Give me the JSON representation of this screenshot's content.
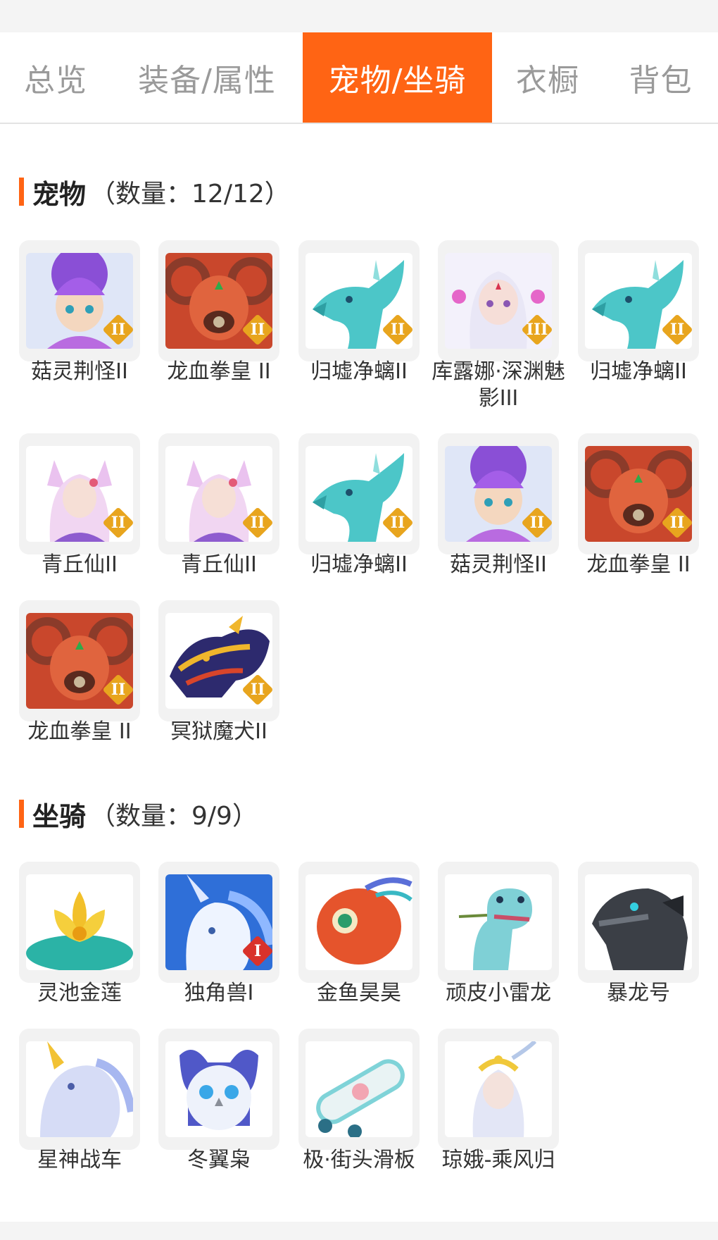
{
  "tabs": [
    {
      "label": "总览",
      "active": false
    },
    {
      "label": "装备/属性",
      "active": false
    },
    {
      "label": "宠物/坐骑",
      "active": true
    },
    {
      "label": "衣橱",
      "active": false
    },
    {
      "label": "背包",
      "active": false
    }
  ],
  "pets": {
    "title": "宠物",
    "count_text": "（数量：12/12）",
    "items": [
      {
        "name": "菇灵荆怪II",
        "icon": "mushroom-sprite-icon",
        "badge": "II"
      },
      {
        "name": "龙血拳皇 II",
        "icon": "ram-demon-icon",
        "badge": "II"
      },
      {
        "name": "归墟净螭II",
        "icon": "cyan-dragon-icon",
        "badge": "II"
      },
      {
        "name": "库露娜·深渊魅影III",
        "icon": "white-hair-girl-icon",
        "badge": "III"
      },
      {
        "name": "归墟净螭II",
        "icon": "cyan-dragon-icon",
        "badge": "II"
      },
      {
        "name": "青丘仙II",
        "icon": "fox-fairy-icon",
        "badge": "II"
      },
      {
        "name": "青丘仙II",
        "icon": "fox-fairy-icon",
        "badge": "II"
      },
      {
        "name": "归墟净螭II",
        "icon": "cyan-dragon-icon",
        "badge": "II"
      },
      {
        "name": "菇灵荆怪II",
        "icon": "mushroom-sprite-icon",
        "badge": "II"
      },
      {
        "name": "龙血拳皇 II",
        "icon": "ram-demon-icon",
        "badge": "II"
      },
      {
        "name": "龙血拳皇 II",
        "icon": "ram-demon-icon",
        "badge": "II"
      },
      {
        "name": "冥狱魔犬II",
        "icon": "hell-hound-icon",
        "badge": "II"
      }
    ]
  },
  "mounts": {
    "title": "坐骑",
    "count_text": "（数量：9/9）",
    "items": [
      {
        "name": "灵池金莲",
        "icon": "golden-lotus-icon",
        "badge": ""
      },
      {
        "name": "独角兽I",
        "icon": "unicorn-icon",
        "badge": "I"
      },
      {
        "name": "金鱼昊昊",
        "icon": "goldfish-icon",
        "badge": ""
      },
      {
        "name": "顽皮小雷龙",
        "icon": "little-dinosaur-icon",
        "badge": ""
      },
      {
        "name": "暴龙号",
        "icon": "mech-rex-icon",
        "badge": ""
      },
      {
        "name": "星神战车",
        "icon": "ice-qilin-icon",
        "badge": ""
      },
      {
        "name": "冬翼枭",
        "icon": "snow-owl-icon",
        "badge": ""
      },
      {
        "name": "极·街头滑板",
        "icon": "skateboard-icon",
        "badge": ""
      },
      {
        "name": "琼娥-乘风归",
        "icon": "moon-fairy-icon",
        "badge": ""
      }
    ]
  },
  "colors": {
    "accent": "#ff6414",
    "badge_gold": "#e8a51e",
    "badge_red": "#d9322b"
  }
}
